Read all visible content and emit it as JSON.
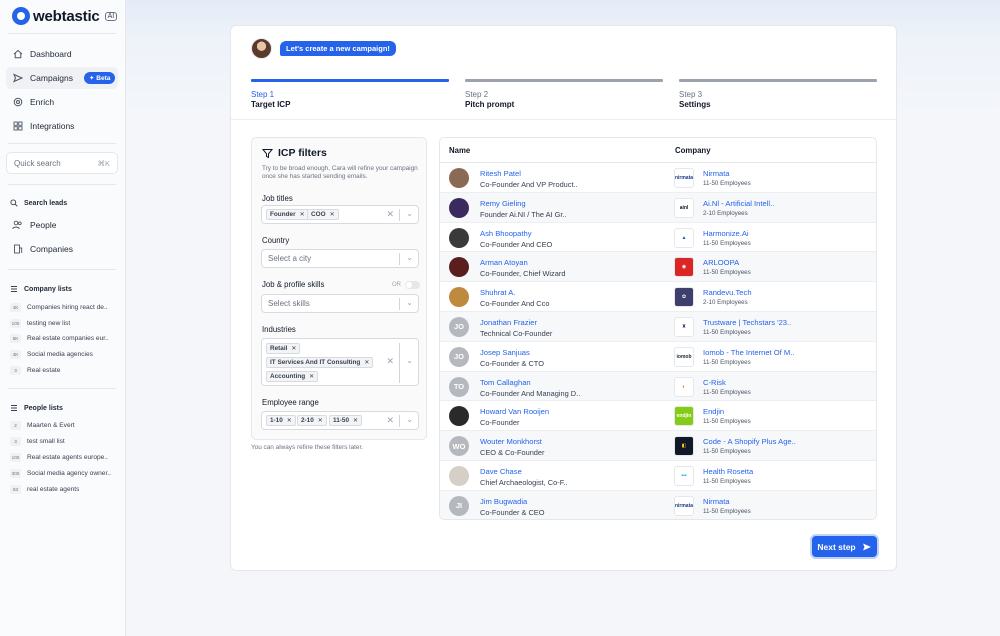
{
  "app": {
    "name": "webtastic",
    "badge": "AI"
  },
  "sidebar": {
    "nav": [
      {
        "label": "Dashboard",
        "icon": "dashboard-icon"
      },
      {
        "label": "Campaigns",
        "icon": "send-icon",
        "badge": "Beta"
      },
      {
        "label": "Enrich",
        "icon": "target-icon"
      },
      {
        "label": "Integrations",
        "icon": "puzzle-icon"
      }
    ],
    "quick_search": {
      "placeholder": "Quick search",
      "shortcut": "⌘K"
    },
    "search_leads": {
      "heading": "Search leads",
      "items": [
        {
          "label": "People"
        },
        {
          "label": "Companies"
        }
      ]
    },
    "company_lists": {
      "heading": "Company lists",
      "items": [
        {
          "count": "4K",
          "label": "Companies hiring react de.."
        },
        {
          "count": "100",
          "label": "testing new list"
        },
        {
          "count": "5K",
          "label": "Real estate companies eur.."
        },
        {
          "count": "4K",
          "label": "Social media agencies"
        },
        {
          "count": "3",
          "label": "Real estate"
        }
      ]
    },
    "people_lists": {
      "heading": "People lists",
      "items": [
        {
          "count": "2",
          "label": "Maarten & Evert"
        },
        {
          "count": "3",
          "label": "test small list"
        },
        {
          "count": "100",
          "label": "Real estate agents europe.."
        },
        {
          "count": "300",
          "label": "Social media agency owner.."
        },
        {
          "count": "83",
          "label": "real estate agents"
        }
      ]
    }
  },
  "campaign": {
    "chat_message": "Let's create a new campaign!",
    "steps": [
      {
        "num": "Step 1",
        "title": "Target ICP",
        "active": true
      },
      {
        "num": "Step 2",
        "title": "Pitch prompt",
        "active": false
      },
      {
        "num": "Step 3",
        "title": "Settings",
        "active": false
      }
    ]
  },
  "filters": {
    "title": "ICP filters",
    "subtitle": "Try to be broad enough, Cara will refine your campaign once she has started sending emails.",
    "job_titles": {
      "label": "Job titles",
      "tags": [
        "Founder",
        "COO"
      ]
    },
    "country": {
      "label": "Country",
      "placeholder": "Select a city"
    },
    "skills": {
      "label": "Job & profile skills",
      "or_label": "OR",
      "placeholder": "Select skills"
    },
    "industries": {
      "label": "Industries",
      "tags": [
        "Retail",
        "IT Services And IT Consulting",
        "Accounting"
      ]
    },
    "employee_range": {
      "label": "Employee range",
      "tags": [
        "1-10",
        "2-10",
        "11-50"
      ]
    },
    "note": "You can always refine these filters later."
  },
  "table": {
    "headers": {
      "name": "Name",
      "company": "Company"
    },
    "rows": [
      {
        "name": "Ritesh Patel",
        "title": "Co-Founder And VP Product..",
        "company": "Nirmata",
        "size": "11-50 Employees",
        "initials": "",
        "avatar_color": "#8a6a55",
        "logo_text": "nirmata",
        "logo_color": "#1e3a8a",
        "logo_bg": "#ffffff"
      },
      {
        "name": "Remy Gieling",
        "title": "Founder Ai.NI / The AI Gr..",
        "company": "Ai.Nl - Artificial Intell..",
        "size": "2-10 Employees",
        "initials": "",
        "avatar_color": "#3b2a5e",
        "logo_text": "ainl",
        "logo_color": "#111827",
        "logo_bg": "#ffffff"
      },
      {
        "name": "Ash Bhoopathy",
        "title": "Co-Founder And CEO",
        "company": "Harmonize.Ai",
        "size": "11-50 Employees",
        "initials": "",
        "avatar_color": "#3a3a3a",
        "logo_text": "▲",
        "logo_color": "#1d4ed8",
        "logo_bg": "#ffffff"
      },
      {
        "name": "Arman Atoyan",
        "title": "Co-Founder, Chief Wizard",
        "company": "ARLOOPA",
        "size": "11-50 Employees",
        "initials": "",
        "avatar_color": "#5a1e1e",
        "logo_text": "◉",
        "logo_color": "#ffffff",
        "logo_bg": "#dc2626"
      },
      {
        "name": "Shuhrat A.",
        "title": "Co-Founder And Cco",
        "company": "Randevu.Tech",
        "size": "2-10 Employees",
        "initials": "",
        "avatar_color": "#c08a3e",
        "logo_text": "✿",
        "logo_color": "#ffffff",
        "logo_bg": "#3f3f6e"
      },
      {
        "name": "Jonathan Frazier",
        "title": "Technical Co-Founder",
        "company": "Trustware | Techstars '23..",
        "size": "11-50 Employees",
        "initials": "JO",
        "avatar_color": "#b5b9bf",
        "logo_text": "♜",
        "logo_color": "#312e81",
        "logo_bg": "#ffffff"
      },
      {
        "name": "Josep Sanjuas",
        "title": "Co-Founder & CTO",
        "company": "Iomob - The Internet Of M..",
        "size": "11-50 Employees",
        "initials": "JO",
        "avatar_color": "#b5b9bf",
        "logo_text": "iomob",
        "logo_color": "#1f2937",
        "logo_bg": "#ffffff"
      },
      {
        "name": "Tom Callaghan",
        "title": "Co-Founder And Managing D..",
        "company": "C-Risk",
        "size": "11-50 Employees",
        "initials": "TO",
        "avatar_color": "#b5b9bf",
        "logo_text": "◐",
        "logo_color": "#ea580c",
        "logo_bg": "#ffffff"
      },
      {
        "name": "Howard Van Rooijen",
        "title": "Co-Founder",
        "company": "Endjin",
        "size": "11-50 Employees",
        "initials": "",
        "avatar_color": "#2a2a2a",
        "logo_text": "endjin",
        "logo_color": "#ffffff",
        "logo_bg": "#84cc16"
      },
      {
        "name": "Wouter Monkhorst",
        "title": "CEO & Co-Founder",
        "company": "Code - A Shopify Plus Age..",
        "size": "11-50 Employees",
        "initials": "WO",
        "avatar_color": "#b5b9bf",
        "logo_text": "◧",
        "logo_color": "#facc15",
        "logo_bg": "#111827"
      },
      {
        "name": "Dave Chase",
        "title": "Chief Archaeologist, Co-F..",
        "company": "Health Rosetta",
        "size": "11-50 Employees",
        "initials": "",
        "avatar_color": "#d6cfc8",
        "logo_text": "•••",
        "logo_color": "#0ea5e9",
        "logo_bg": "#ffffff"
      },
      {
        "name": "Jim Bugwadia",
        "title": "Co-Founder & CEO",
        "company": "Nirmata",
        "size": "11-50 Employees",
        "initials": "JI",
        "avatar_color": "#b5b9bf",
        "logo_text": "nirmata",
        "logo_color": "#1e3a8a",
        "logo_bg": "#ffffff"
      }
    ]
  },
  "next_button": {
    "label": "Next step"
  },
  "colors": {
    "accent": "#2563eb",
    "text": "#111827",
    "muted": "#6b7280"
  }
}
